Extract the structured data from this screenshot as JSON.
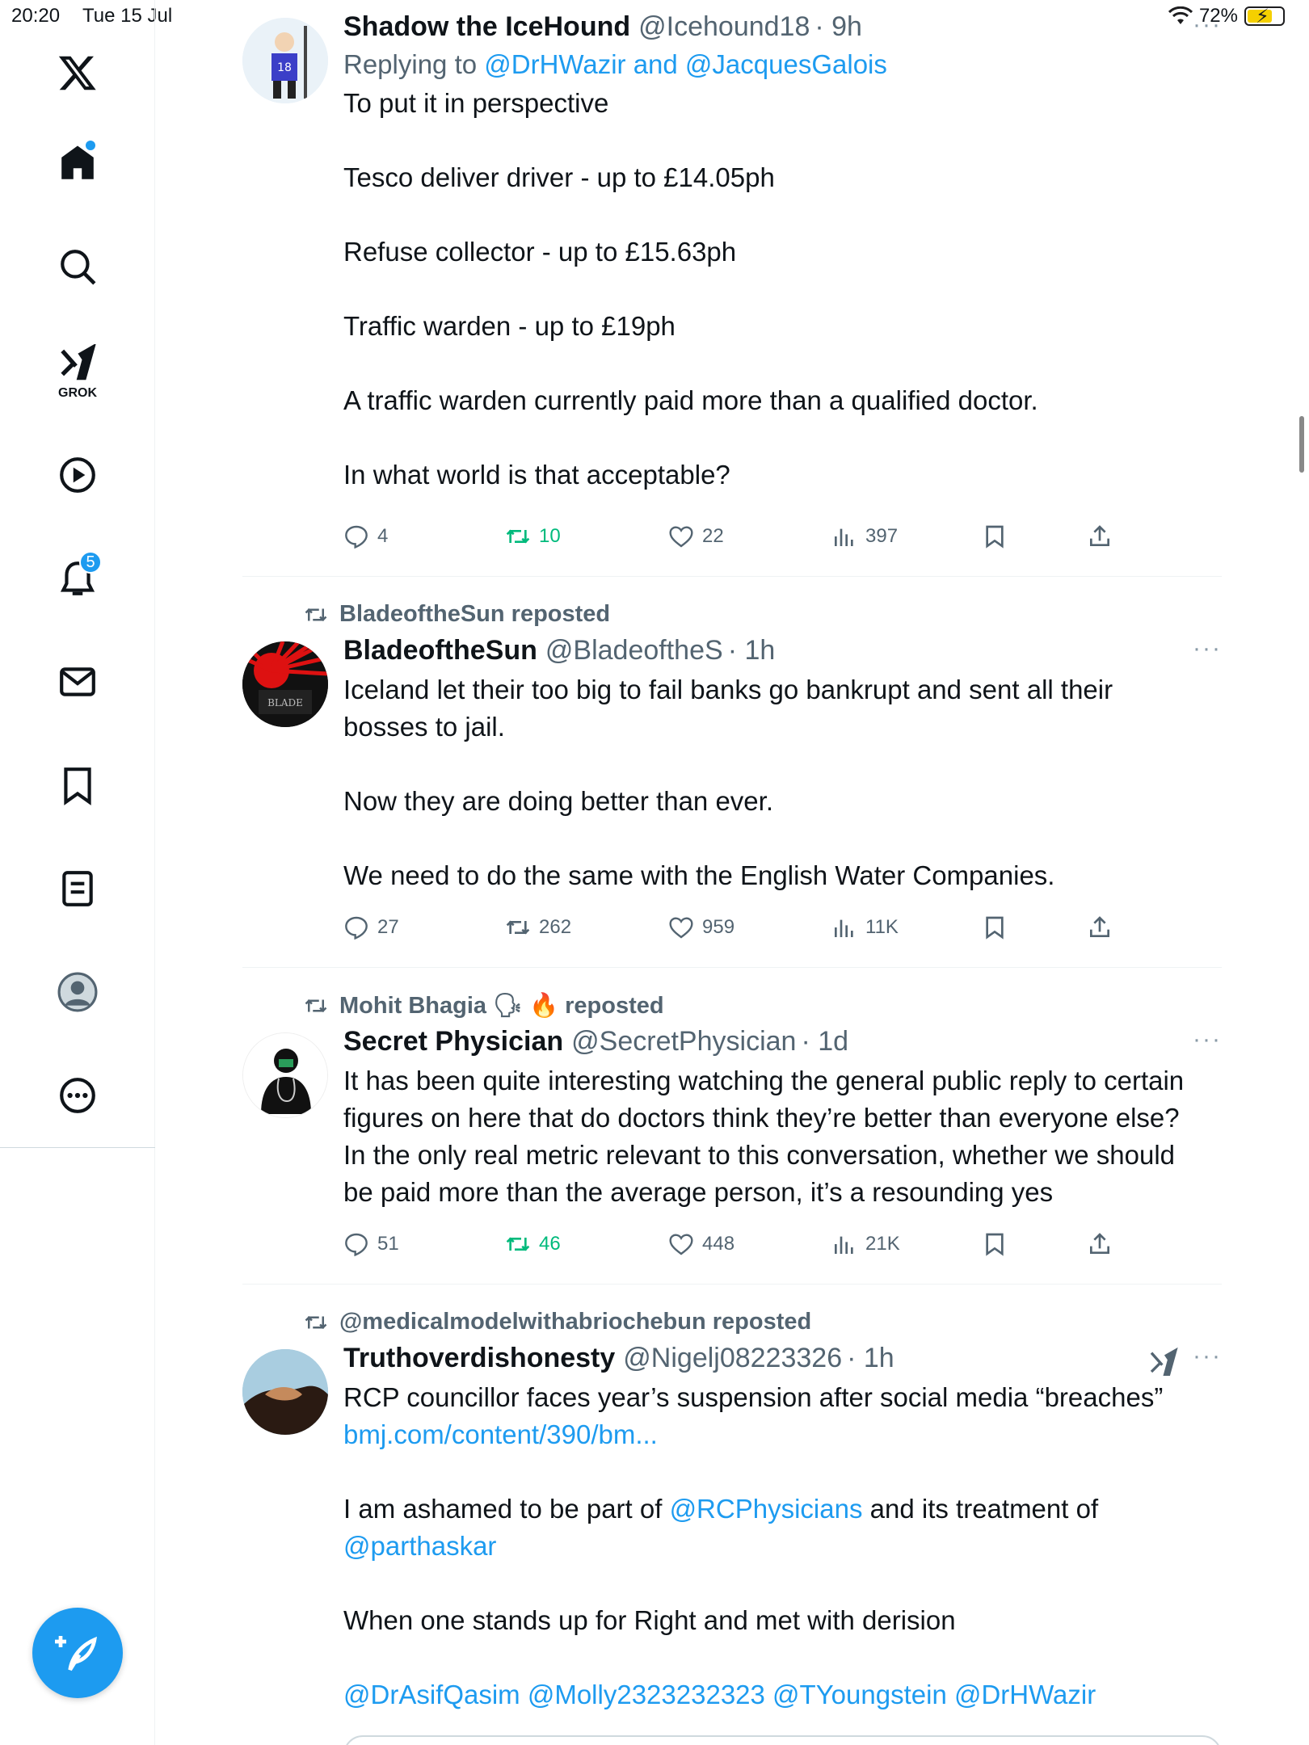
{
  "status": {
    "time": "20:20",
    "date": "Tue 15 Jul",
    "battery": "72%",
    "battery_level": 0.72
  },
  "sidebar": {
    "logo": "x-logo-icon",
    "grok_label": "GROK",
    "notification_count": "5",
    "items": [
      "home-icon",
      "search-icon",
      "grok-icon",
      "video-icon",
      "notifications-icon",
      "messages-icon",
      "bookmarks-icon",
      "lists-icon",
      "profile-icon",
      "more-icon"
    ]
  },
  "tweets": [
    {
      "name": "Shadow the IceHound",
      "handle": "@Icehound18",
      "time": "· 9h",
      "reply_prefix": "Replying to",
      "reply_users": "@DrHWazir and @JacquesGalois",
      "lines": [
        "To put it in perspective",
        "",
        "Tesco deliver driver - up to £14.05ph",
        "",
        "Refuse collector - up to £15.63ph",
        "",
        "Traffic warden - up to £19ph",
        "",
        "A traffic warden currently paid more than a qualified doctor.",
        "",
        "In what world is that acceptable?"
      ],
      "replies": "4",
      "reposts": "10",
      "likes": "22",
      "views": "397"
    },
    {
      "repost_by": "BladeoftheSun reposted",
      "name": "BladeoftheSun",
      "handle": "@BladeoftheS",
      "time": "· 1h",
      "lines": [
        "Iceland let their too big to fail banks go bankrupt and sent all their",
        "bosses to jail.",
        "",
        "Now they are doing better than ever.",
        "",
        "We need to do the same with the English Water Companies."
      ],
      "replies": "27",
      "reposts": "262",
      "likes": "959",
      "views": "11K"
    },
    {
      "repost_by": "Mohit Bhagia 🗣 🔥 reposted",
      "name": "Secret Physician",
      "handle": "@SecretPhysician",
      "time": "· 1d",
      "lines": [
        "It has been quite interesting watching the general public reply to certain",
        "figures on here that do doctors think they’re better than everyone else?",
        "In the only real metric relevant to this conversation, whether we should",
        "be paid more than the average person, it’s a resounding yes"
      ],
      "replies": "51",
      "reposts": "46",
      "likes": "448",
      "views": "21K"
    },
    {
      "repost_by": "@medicalmodelwithabriochebun reposted",
      "name": "Truthoverdishonesty",
      "handle": "@Nigelj08223326",
      "time": "· 1h",
      "line1": "RCP councillor faces year’s suspension after social media “breaches”",
      "url": "bmj.com/content/390/bm...",
      "line3_pre": "I am ashamed to be part of ",
      "line3_link": "@RCPhysicians",
      "line3_post": " and its treatment of",
      "line4_link": "@parthaskar",
      "line5": "When one stands up for Right and met with derision",
      "mentions": "@DrAsifQasim @Molly2323232323 @TYoungstein @DrHWazir"
    }
  ],
  "more_label": "···"
}
